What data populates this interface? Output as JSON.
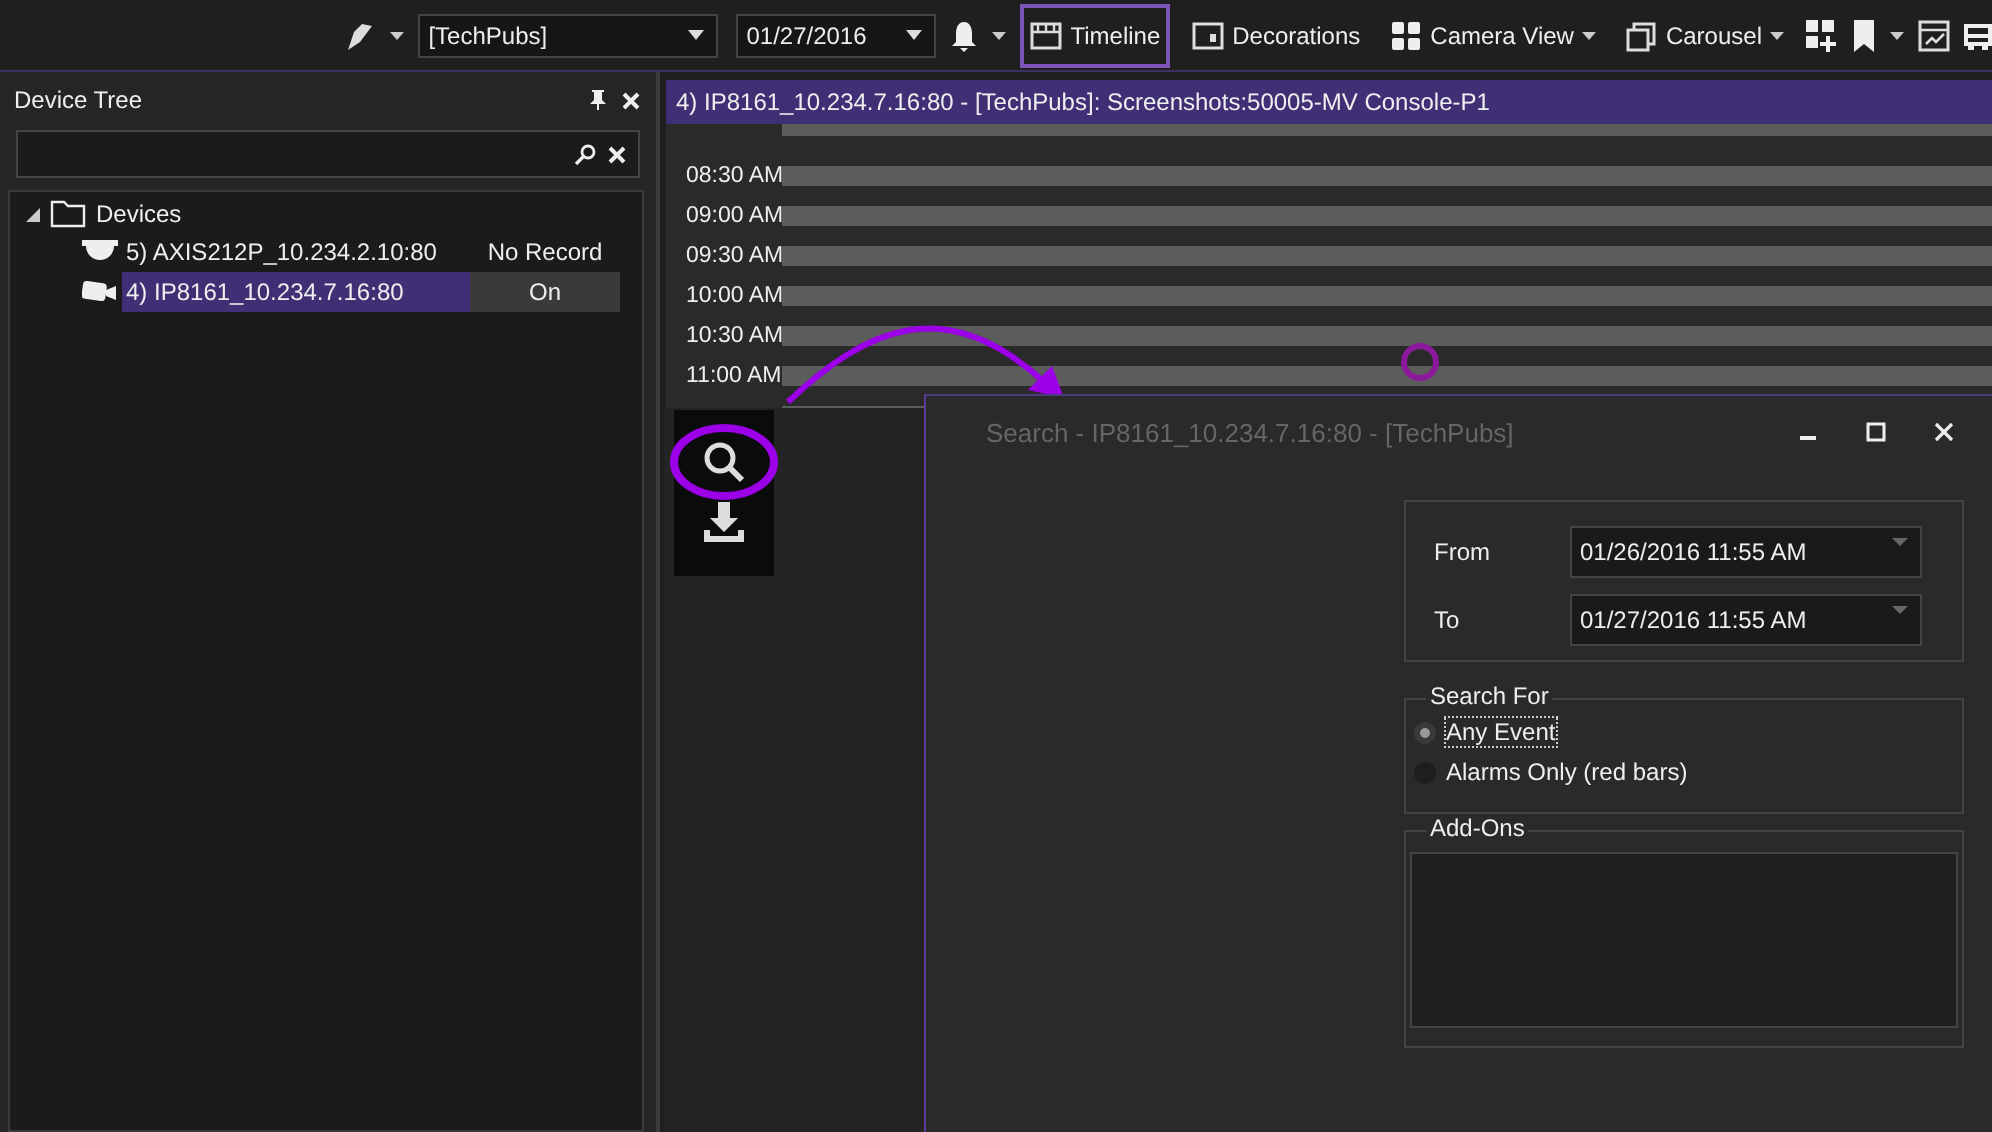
{
  "toolbar": {
    "profile": "[TechPubs]",
    "date": "01/27/2016",
    "buttons": [
      {
        "label": "Timeline",
        "kind": "timeline",
        "selected": true,
        "dropdown": false
      },
      {
        "label": "Decorations",
        "kind": "decorations",
        "selected": false,
        "dropdown": false
      },
      {
        "label": "Camera View",
        "kind": "grid",
        "selected": false,
        "dropdown": true
      },
      {
        "label": "Carousel",
        "kind": "carousel",
        "selected": false,
        "dropdown": true
      }
    ]
  },
  "device_tree": {
    "title": "Device Tree",
    "root": {
      "label": "Devices",
      "expanded": true,
      "children": [
        {
          "label": "5) AXIS212P_10.234.2.10:80",
          "status": "No Record",
          "kind": "dome",
          "selected": false
        },
        {
          "label": "4) IP8161_10.234.7.16:80",
          "status": "On",
          "kind": "box",
          "selected": true
        }
      ]
    }
  },
  "viewer": {
    "title": "4) IP8161_10.234.7.16:80 - [TechPubs]: Screenshots:50005-MV Console-P1",
    "time_rows": [
      "08:30 AM",
      "09:00 AM",
      "09:30 AM",
      "10:00 AM",
      "10:30 AM",
      "11:00 AM"
    ]
  },
  "search_dialog": {
    "title": "Search - IP8161_10.234.7.16:80 - [TechPubs]",
    "range": [
      {
        "label": "From",
        "value": "01/26/2016 11:55 AM"
      },
      {
        "label": "To",
        "value": "01/27/2016 11:55 AM"
      }
    ],
    "search_for": {
      "title": "Search For",
      "options": [
        {
          "label": "Any Event",
          "selected": true
        },
        {
          "label": "Alarms Only (red bars)",
          "selected": false
        }
      ]
    },
    "addons": {
      "title": "Add-Ons"
    }
  }
}
